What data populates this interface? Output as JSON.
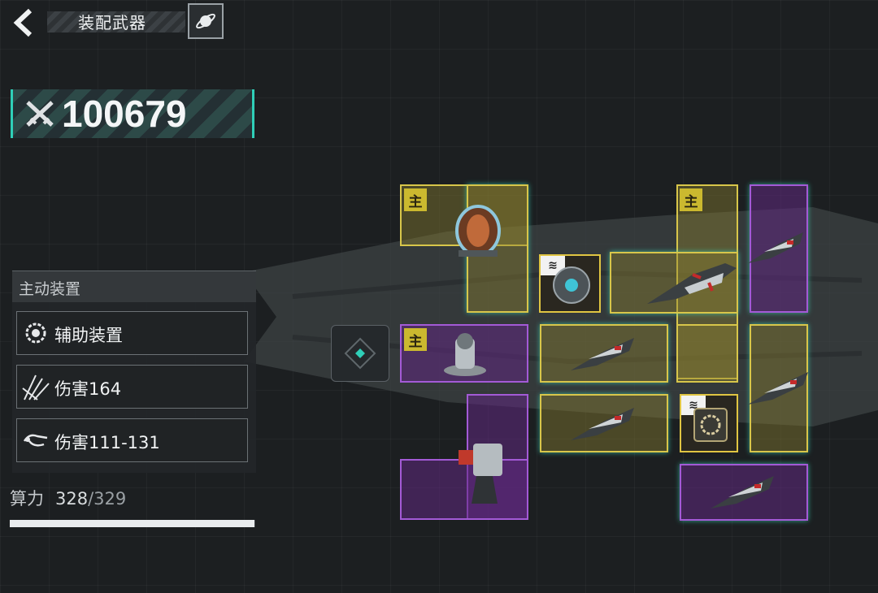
{
  "header": {
    "title": "装配武器",
    "back_icon": "chevron-left-icon",
    "planet_icon": "planet-icon"
  },
  "power": {
    "value": "100679",
    "icon": "crossed-swords-icon"
  },
  "panel": {
    "title": "主动装置",
    "rows": [
      {
        "icon": "gear-icon",
        "label": "辅助装置"
      },
      {
        "icon": "claw-icon",
        "label": "伤害164"
      },
      {
        "icon": "hand-icon",
        "label": "伤害111-131"
      }
    ]
  },
  "compute": {
    "label": "算力",
    "current": "328",
    "max": "/329",
    "progress": 0.997
  },
  "grid": {
    "main_badge": "主",
    "module_badge": "≋"
  },
  "colors": {
    "yellow_slot": "#d8c64a",
    "purple_slot": "#a35ad6",
    "accent": "#2fcfb8"
  }
}
